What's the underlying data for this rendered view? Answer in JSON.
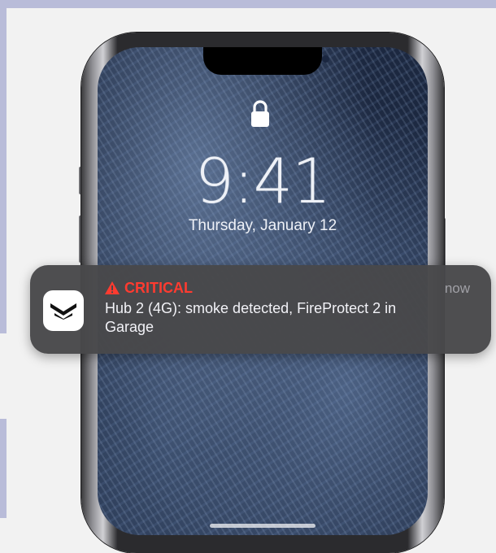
{
  "lock_screen": {
    "time": "9:41",
    "date": "Thursday, January 12",
    "lock_icon": "lock-icon"
  },
  "notification": {
    "app_icon": "ajax-logo-icon",
    "alert_icon": "warning-triangle-icon",
    "level": "CRITICAL",
    "level_color": "#ff3b30",
    "time": "now",
    "message": "Hub 2 (4G): smoke detected, FireProtect 2 in Garage"
  },
  "colors": {
    "frame": "#b9bcd9",
    "banner": "#48484a"
  }
}
